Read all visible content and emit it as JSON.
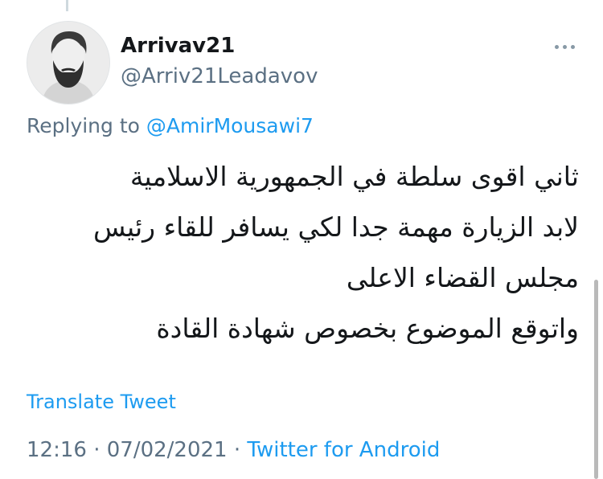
{
  "tweet": {
    "author": {
      "display_name": "Arrivav21",
      "handle": "@Arriv21Leadavov",
      "avatar_icon": "bearded-man-avatar"
    },
    "more_icon": "more-horizontal-icon",
    "reply": {
      "prefix": "Replying to ",
      "mention": "@AmirMousawi7"
    },
    "text_lines": [
      "ثاني اقوى سلطة في الجمهورية الاسلامية",
      "لابد الزيارة مهمة جدا لكي يسافر للقاء رئيس",
      "مجلس القضاء الاعلى",
      "واتوقع الموضوع بخصوص شهادة القادة"
    ],
    "translate_label": "Translate Tweet",
    "time": "12:16",
    "separator": " · ",
    "date": "07/02/2021",
    "source": "Twitter for Android"
  },
  "colors": {
    "text_primary": "#14171a",
    "text_secondary": "#5b7083",
    "link": "#1d9bf0",
    "background": "#ffffff"
  }
}
